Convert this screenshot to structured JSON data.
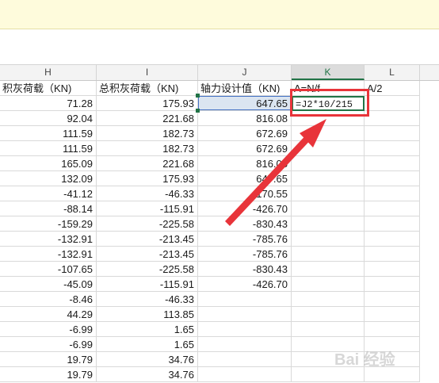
{
  "columns": [
    {
      "letter": "H",
      "active": false
    },
    {
      "letter": "I",
      "active": false
    },
    {
      "letter": "J",
      "active": false
    },
    {
      "letter": "K",
      "active": true
    },
    {
      "letter": "L",
      "active": false
    }
  ],
  "header_row": {
    "H": "积灰荷载（KN)",
    "I": "总积灰荷载（KN)",
    "J": "轴力设计值（KN)",
    "K": "A=N/f",
    "L": "A/2"
  },
  "rows": [
    {
      "H": "71.28",
      "I": "175.93",
      "J": "647.65"
    },
    {
      "H": "92.04",
      "I": "221.68",
      "J": "816.08"
    },
    {
      "H": "111.59",
      "I": "182.73",
      "J": "672.69"
    },
    {
      "H": "111.59",
      "I": "182.73",
      "J": "672.69"
    },
    {
      "H": "165.09",
      "I": "221.68",
      "J": "816.08"
    },
    {
      "H": "132.09",
      "I": "175.93",
      "J": "647.65"
    },
    {
      "H": "-41.12",
      "I": "-46.33",
      "J": "-170.55"
    },
    {
      "H": "-88.14",
      "I": "-115.91",
      "J": "-426.70"
    },
    {
      "H": "-159.29",
      "I": "-225.58",
      "J": "-830.43"
    },
    {
      "H": "-132.91",
      "I": "-213.45",
      "J": "-785.76"
    },
    {
      "H": "-132.91",
      "I": "-213.45",
      "J": "-785.76"
    },
    {
      "H": "-107.65",
      "I": "-225.58",
      "J": "-830.43"
    },
    {
      "H": "-45.09",
      "I": "-115.91",
      "J": "-426.70"
    },
    {
      "H": "-8.46",
      "I": "-46.33",
      "J": ""
    },
    {
      "H": "44.29",
      "I": "113.85",
      "J": ""
    },
    {
      "H": "-6.99",
      "I": "1.65",
      "J": ""
    },
    {
      "H": "-6.99",
      "I": "1.65",
      "J": ""
    },
    {
      "H": "19.79",
      "I": "34.76",
      "J": ""
    },
    {
      "H": "19.79",
      "I": "34.76",
      "J": ""
    }
  ],
  "editing_cell": {
    "column": "K",
    "row_index": 0,
    "formula": "=J2*10/215"
  },
  "selected_cell": {
    "column": "J",
    "row_index": 0
  },
  "annotation": {
    "color": "#e8343a"
  },
  "accent_color": "#217346",
  "watermark_text": "Bai 经验"
}
